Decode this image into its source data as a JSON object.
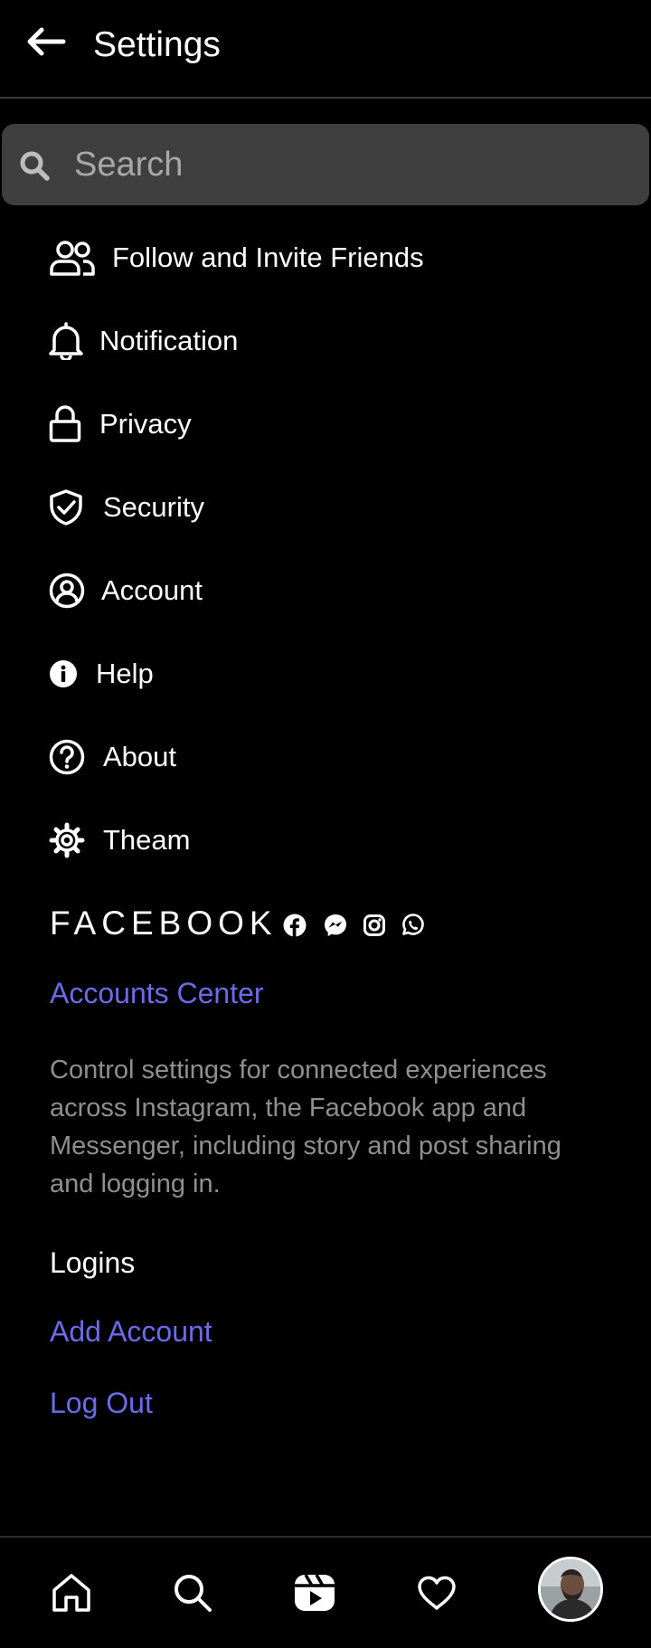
{
  "header": {
    "title": "Settings"
  },
  "search": {
    "placeholder": "Search"
  },
  "menu": [
    {
      "label": "Follow and Invite Friends",
      "icon": "add-friends-icon"
    },
    {
      "label": "Notification",
      "icon": "bell-icon"
    },
    {
      "label": "Privacy",
      "icon": "lock-icon"
    },
    {
      "label": "Security",
      "icon": "shield-check-icon"
    },
    {
      "label": "Account",
      "icon": "user-circle-icon"
    },
    {
      "label": "Help",
      "icon": "info-icon"
    },
    {
      "label": "About",
      "icon": "question-circle-icon"
    },
    {
      "label": "Theam",
      "icon": "gear-icon"
    }
  ],
  "facebook": {
    "wordmark": "FACEBOOK",
    "icons": [
      "facebook-icon",
      "messenger-icon",
      "instagram-icon",
      "whatsapp-icon"
    ]
  },
  "accounts_center": {
    "label": "Accounts Center",
    "description": "Control settings for connected experiences across Instagram, the Facebook app and Messenger, including story and post sharing and logging in."
  },
  "logins": {
    "title": "Logins",
    "add_account": "Add Account",
    "log_out": "Log Out"
  },
  "bottom_nav": {
    "items": [
      "home-icon",
      "search-icon",
      "reels-icon",
      "heart-icon",
      "avatar"
    ]
  },
  "colors": {
    "background": "#000000",
    "search_bg": "#3f3f3f",
    "link": "#6b6bea",
    "muted_text": "#8f8f8f"
  }
}
